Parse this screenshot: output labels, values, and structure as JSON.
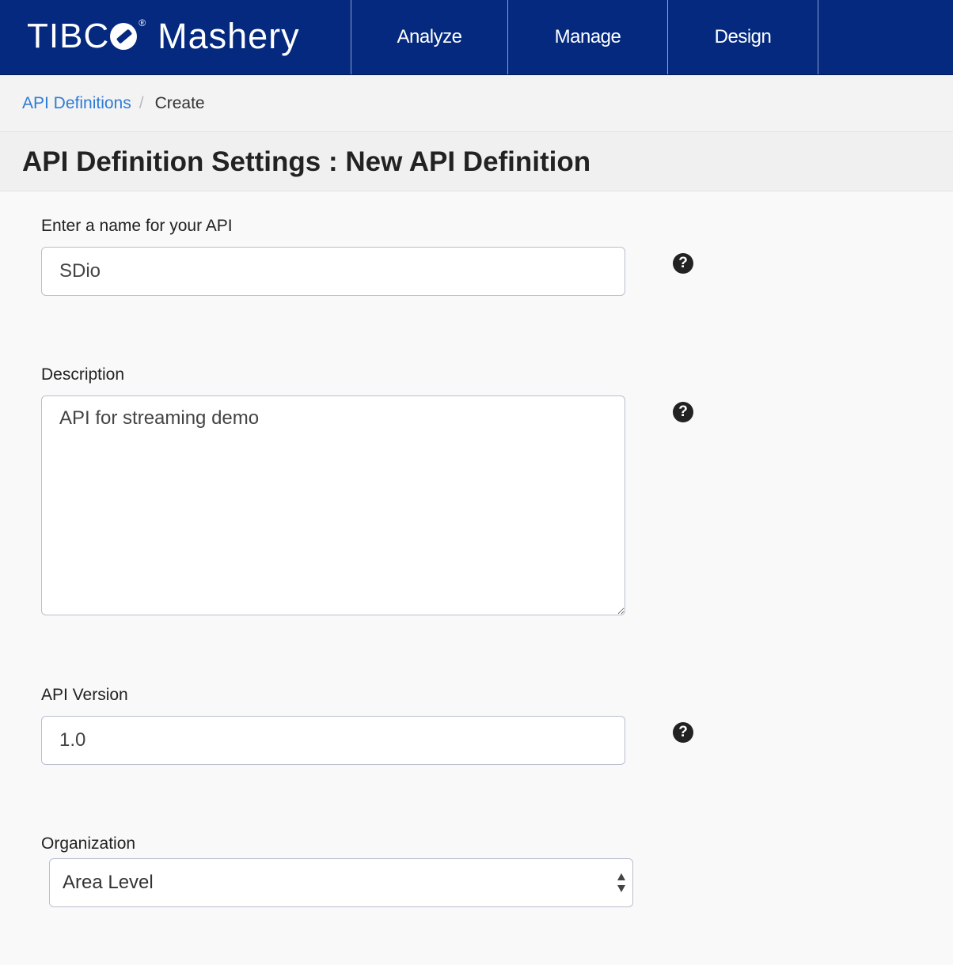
{
  "brand": {
    "name_part1": "TIBC",
    "registered": "®",
    "name_part2": "Mashery"
  },
  "nav": {
    "tabs": [
      {
        "label": "Analyze"
      },
      {
        "label": "Manage"
      },
      {
        "label": "Design"
      }
    ]
  },
  "breadcrumb": {
    "parent": "API Definitions",
    "separator": "/",
    "current": "Create"
  },
  "page": {
    "title": "API Definition Settings : New API Definition"
  },
  "form": {
    "name": {
      "label": "Enter a name for your API",
      "value": "SDio"
    },
    "description": {
      "label": "Description",
      "value": "API for streaming demo"
    },
    "version": {
      "label": "API Version",
      "value": "1.0"
    },
    "organization": {
      "label": "Organization",
      "selected": "Area Level"
    },
    "help_glyph": "?"
  },
  "colors": {
    "nav_bg": "#04297e",
    "link": "#2f7bd6"
  }
}
